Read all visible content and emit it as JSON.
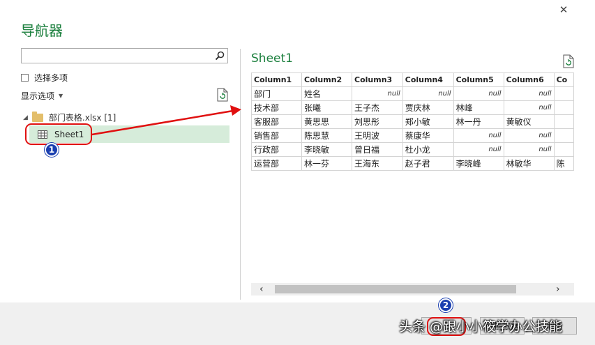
{
  "window": {
    "title": "导航器",
    "close_glyph": "✕"
  },
  "left": {
    "search": {
      "value": "",
      "placeholder": ""
    },
    "multi_select_label": "选择多项",
    "display_options_label": "显示选项",
    "tree": {
      "file_label": "部门表格.xlsx [1]",
      "sheet_label": "Sheet1"
    }
  },
  "preview": {
    "title": "Sheet1",
    "columns": [
      "Column1",
      "Column2",
      "Column3",
      "Column4",
      "Column5",
      "Column6",
      "Co"
    ],
    "rows": [
      [
        "部门",
        "姓名",
        "null",
        "null",
        "null",
        "null",
        ""
      ],
      [
        "技术部",
        "张曦",
        "王子杰",
        "贾庆林",
        "林峰",
        "null",
        ""
      ],
      [
        "客服部",
        "黄思思",
        "刘思彤",
        "郑小敏",
        "林一丹",
        "黄敏仪",
        ""
      ],
      [
        "销售部",
        "陈思慧",
        "王明波",
        "蔡康华",
        "null",
        "null",
        ""
      ],
      [
        "行政部",
        "李晓敏",
        "曾日福",
        "杜小龙",
        "null",
        "null",
        ""
      ],
      [
        "运营部",
        "林一芬",
        "王海东",
        "赵子君",
        "李晓峰",
        "林敏华",
        "陈"
      ]
    ],
    "scroll_left": "‹",
    "scroll_right": "›"
  },
  "annotations": {
    "badge1": "1",
    "badge2": "2"
  },
  "footer": {
    "load_label": "",
    "transform_label": "转换数据",
    "cancel_label": "取消",
    "watermark": "头条 @跟小小筱学办公技能"
  },
  "colors": {
    "accent": "#1b7f3d",
    "highlight": "#e01010",
    "badge": "#1a3fb0",
    "selection": "#d6ecda"
  }
}
